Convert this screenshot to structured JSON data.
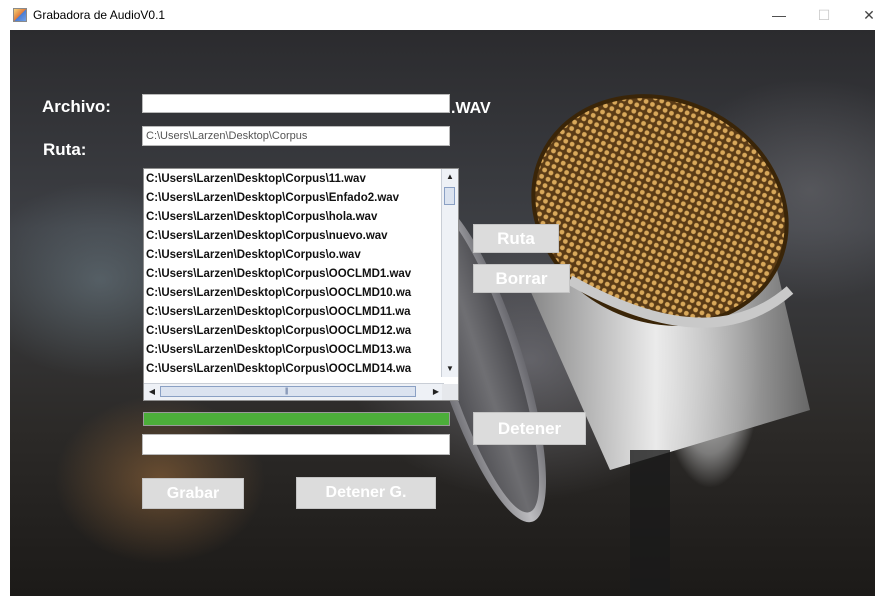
{
  "window": {
    "title": "Grabadora de AudioV0.1",
    "minimize_glyph": "—",
    "maximize_glyph": "☐",
    "close_glyph": "✕"
  },
  "form": {
    "archivo_label": "Archivo:",
    "archivo_value": "",
    "wav_suffix": ".WAV",
    "ruta_label": "Ruta:",
    "ruta_value": "C:\\Users\\Larzen\\Desktop\\Corpus"
  },
  "file_list": {
    "items": [
      "C:\\Users\\Larzen\\Desktop\\Corpus\\11.wav",
      "C:\\Users\\Larzen\\Desktop\\Corpus\\Enfado2.wav",
      "C:\\Users\\Larzen\\Desktop\\Corpus\\hola.wav",
      "C:\\Users\\Larzen\\Desktop\\Corpus\\nuevo.wav",
      "C:\\Users\\Larzen\\Desktop\\Corpus\\o.wav",
      "C:\\Users\\Larzen\\Desktop\\Corpus\\OOCLMD1.wav",
      "C:\\Users\\Larzen\\Desktop\\Corpus\\OOCLMD10.wa",
      "C:\\Users\\Larzen\\Desktop\\Corpus\\OOCLMD11.wa",
      "C:\\Users\\Larzen\\Desktop\\Corpus\\OOCLMD12.wa",
      "C:\\Users\\Larzen\\Desktop\\Corpus\\OOCLMD13.wa",
      "C:\\Users\\Larzen\\Desktop\\Corpus\\OOCLMD14.wa"
    ]
  },
  "buttons": {
    "ruta": "Ruta",
    "borrar": "Borrar",
    "detener": "Detener",
    "grabar": "Grabar",
    "detener_g": "Detener G."
  },
  "progress": {
    "fraction": 1.0,
    "color": "#4cae3a"
  },
  "status": {
    "value": ""
  },
  "icons": {
    "app": "java-cup-icon",
    "scroll_up": "▲",
    "scroll_down": "▼",
    "scroll_left": "◀",
    "scroll_right": "▶",
    "scroll_grip": "|||"
  }
}
